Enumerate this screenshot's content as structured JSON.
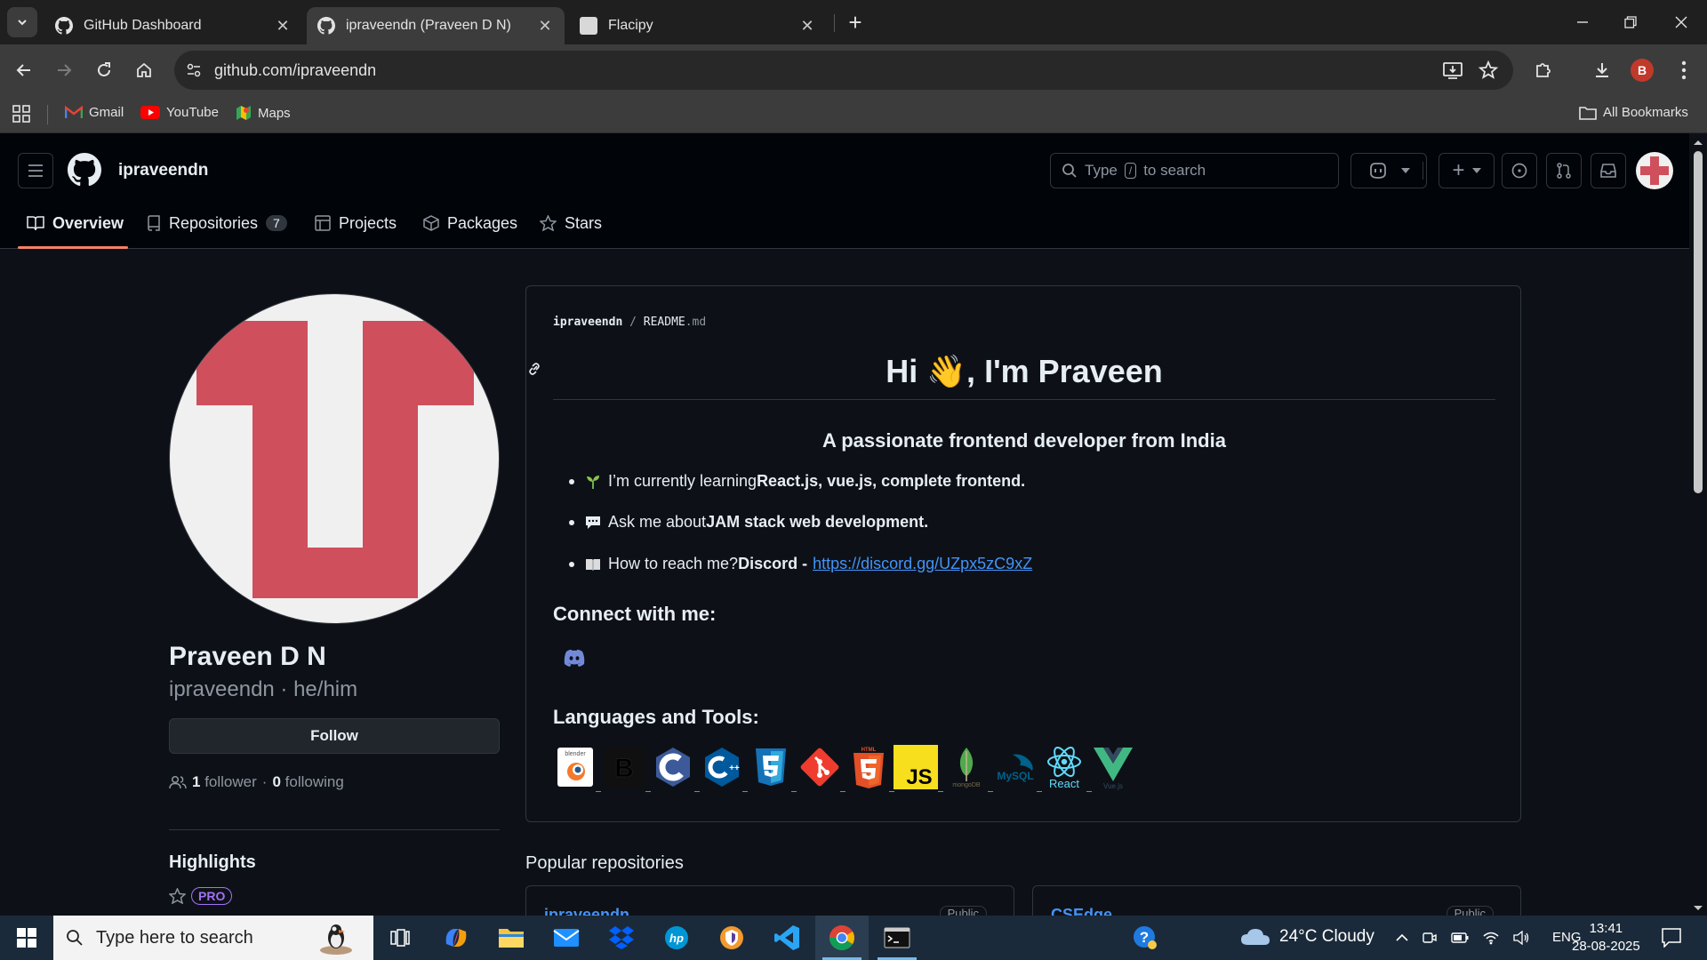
{
  "browser": {
    "tabs": [
      {
        "title": "GitHub Dashboard",
        "active": false
      },
      {
        "title": "ipraveendn (Praveen D N)",
        "active": true
      },
      {
        "title": "Flacipy",
        "active": false
      }
    ],
    "url": "github.com/ipraveendn",
    "profile_initial": "B",
    "bookmarks": [
      "Gmail",
      "YouTube",
      "Maps"
    ],
    "all_bookmarks": "All Bookmarks"
  },
  "header": {
    "username": "ipraveendn",
    "search_prefix": "Type",
    "search_key": "/",
    "search_suffix": "to search"
  },
  "nav": {
    "tabs": [
      {
        "label": "Overview",
        "icon": "book-icon",
        "active": true
      },
      {
        "label": "Repositories",
        "icon": "repo-icon",
        "count": "7"
      },
      {
        "label": "Projects",
        "icon": "table-icon"
      },
      {
        "label": "Packages",
        "icon": "package-icon"
      },
      {
        "label": "Stars",
        "icon": "star-icon"
      }
    ]
  },
  "profile": {
    "name": "Praveen D N",
    "login_pronouns": "ipraveendn · he/him",
    "follow_label": "Follow",
    "followers_count": "1",
    "followers_label": "follower",
    "sep": "·",
    "following_count": "0",
    "following_label": "following",
    "highlights_title": "Highlights",
    "pro_badge": "PRO"
  },
  "readme": {
    "owner": "ipraveendn",
    "slash": "/",
    "file": "README",
    "ext": ".md",
    "h1": "Hi 👋, I'm Praveen",
    "subtitle": "A passionate frontend developer from India",
    "items": [
      {
        "text": "I’m currently learning ",
        "bold": "React.js, vue.js, complete frontend."
      },
      {
        "text": "Ask me about ",
        "bold": "JAM stack web development."
      },
      {
        "text": "How to reach me? ",
        "bold": "Discord - ",
        "link": "https://discord.gg/UZpx5zC9xZ"
      }
    ],
    "connect_title": "Connect with me:",
    "languages_title": "Languages and Tools:",
    "tools": [
      "blender",
      "bootstrap",
      "c",
      "cplusplus",
      "css3",
      "git",
      "html5",
      "javascript",
      "mongodb",
      "mysql",
      "react",
      "vuejs"
    ],
    "tool_labels": {
      "mongodb": "mongoDB",
      "mysql": "MySQL",
      "react": "React",
      "vuejs": "Vue.js",
      "blender": "blender"
    }
  },
  "popular": {
    "title": "Popular repositories",
    "repos": [
      {
        "name": "ipraveendn",
        "visibility": "Public"
      },
      {
        "name": "CSEdge",
        "visibility": "Public"
      }
    ]
  },
  "taskbar": {
    "search_placeholder": "Type here to search",
    "weather": "24°C  Cloudy",
    "lang": "ENG",
    "time": "13:41",
    "date": "28-08-2025"
  },
  "colors": {
    "accent_underline": "#f78166",
    "link": "#4493f8",
    "avatar_red": "#cf4f5c",
    "bg": "#0d1117"
  }
}
